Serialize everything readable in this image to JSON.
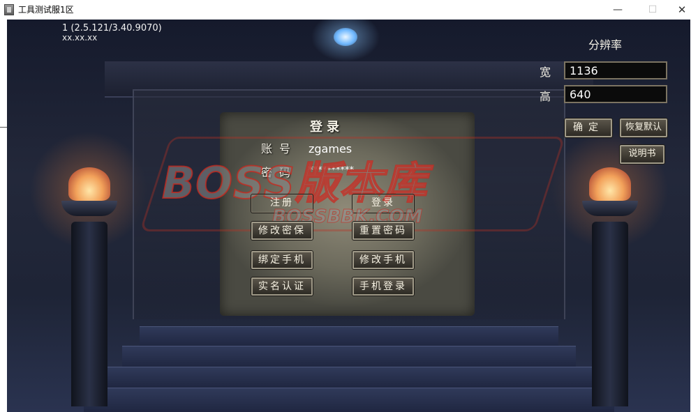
{
  "window": {
    "title": "工具测试服1区",
    "icon": "game-window-icon",
    "controls": {
      "minimize": "—",
      "maximize": "☐",
      "close": "✕"
    }
  },
  "server": {
    "line": "1 (2.5.121/3.40.9070)",
    "address": "xx.xx.xx"
  },
  "login": {
    "title": "登录",
    "account_label": "账号",
    "account_value": "zgames",
    "password_label": "密码",
    "password_value": "**********",
    "buttons": {
      "register": "注册",
      "login": "登录",
      "change_password": "修改密保",
      "reset_password": "重置密码",
      "bind_phone": "绑定手机",
      "change_phone": "修改手机",
      "real_name": "实名认证",
      "phone_login": "手机登录"
    }
  },
  "resolution": {
    "title": "分辨率",
    "width_label": "宽",
    "width_value": "1136",
    "height_label": "高",
    "height_value": "640",
    "ok_button": "确定",
    "default_button": "恢复默认",
    "manual_button": "说明书"
  },
  "watermark": {
    "main": "BOSS版本库",
    "sub": "BOSSBBK.COM"
  },
  "colors": {
    "text": "#f4f1e6",
    "button_border": "#a09a88",
    "watermark_red": "#c8281e",
    "input_bg": "#0b0b0b"
  }
}
